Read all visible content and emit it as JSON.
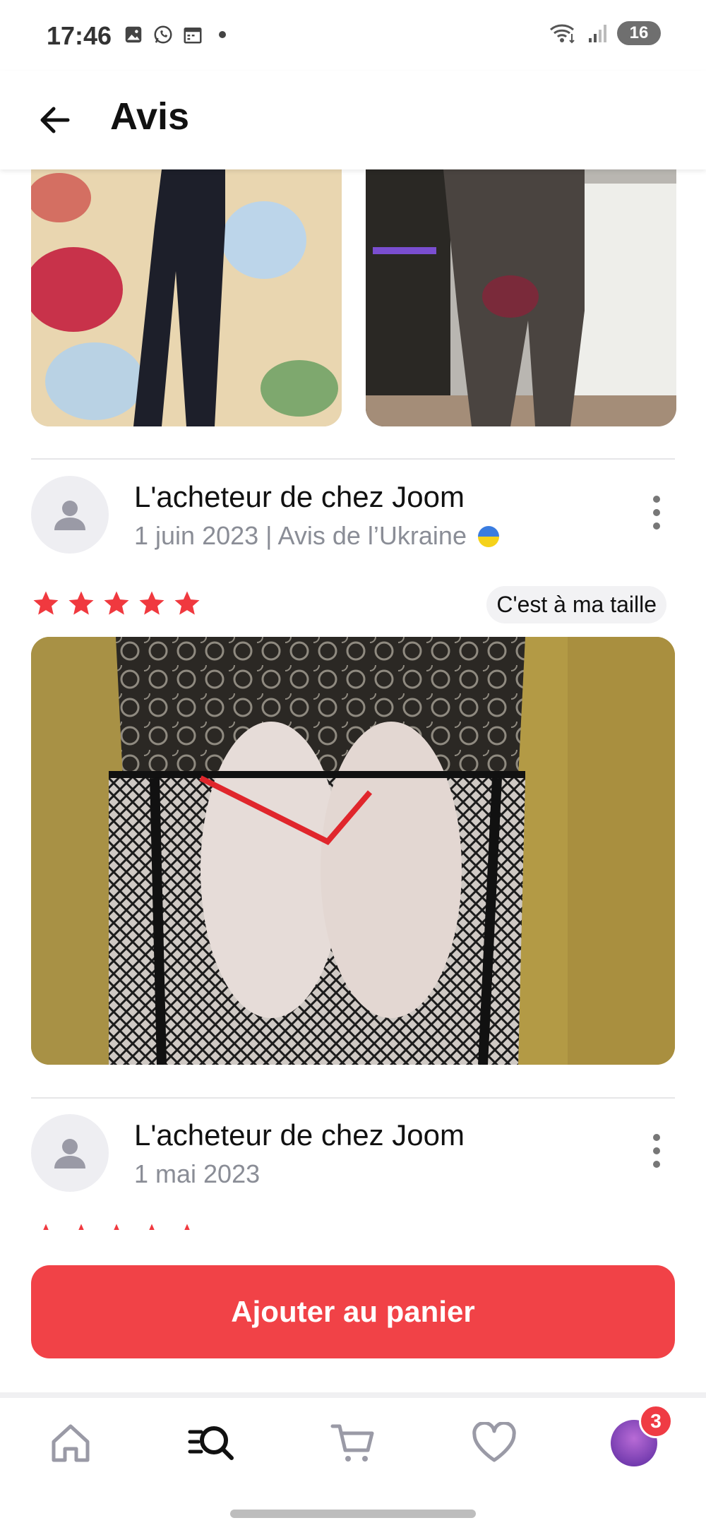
{
  "status_bar": {
    "time": "17:46",
    "battery": "16",
    "icons": [
      "gallery-icon",
      "whatsapp-icon",
      "calendar-icon",
      "notification-dot",
      "wifi-icon",
      "signal-icon"
    ]
  },
  "header": {
    "title": "Avis",
    "back_icon": "arrow-left-icon"
  },
  "reviews": [
    {
      "author": "L'acheteur de chez Joom",
      "date": "1 juin 2023",
      "origin": "Avis de l’Ukraine",
      "meta": "1 juin 2023 | Avis de l’Ukraine",
      "rating": 5,
      "fit_badge": "C'est à ma taille"
    },
    {
      "author": "L'acheteur de chez Joom",
      "date": "1 mai 2023",
      "meta": "1 mai 2023",
      "rating": 5
    }
  ],
  "cta": {
    "label": "Ajouter au panier"
  },
  "bottom_nav": {
    "items": [
      "home-icon",
      "search-catalog-icon",
      "cart-icon",
      "favorites-heart-icon",
      "profile-avatar"
    ],
    "profile_badge": "3"
  },
  "colors": {
    "accent": "#f14247",
    "star": "#f0393f",
    "meta_text": "#8a8d96"
  }
}
